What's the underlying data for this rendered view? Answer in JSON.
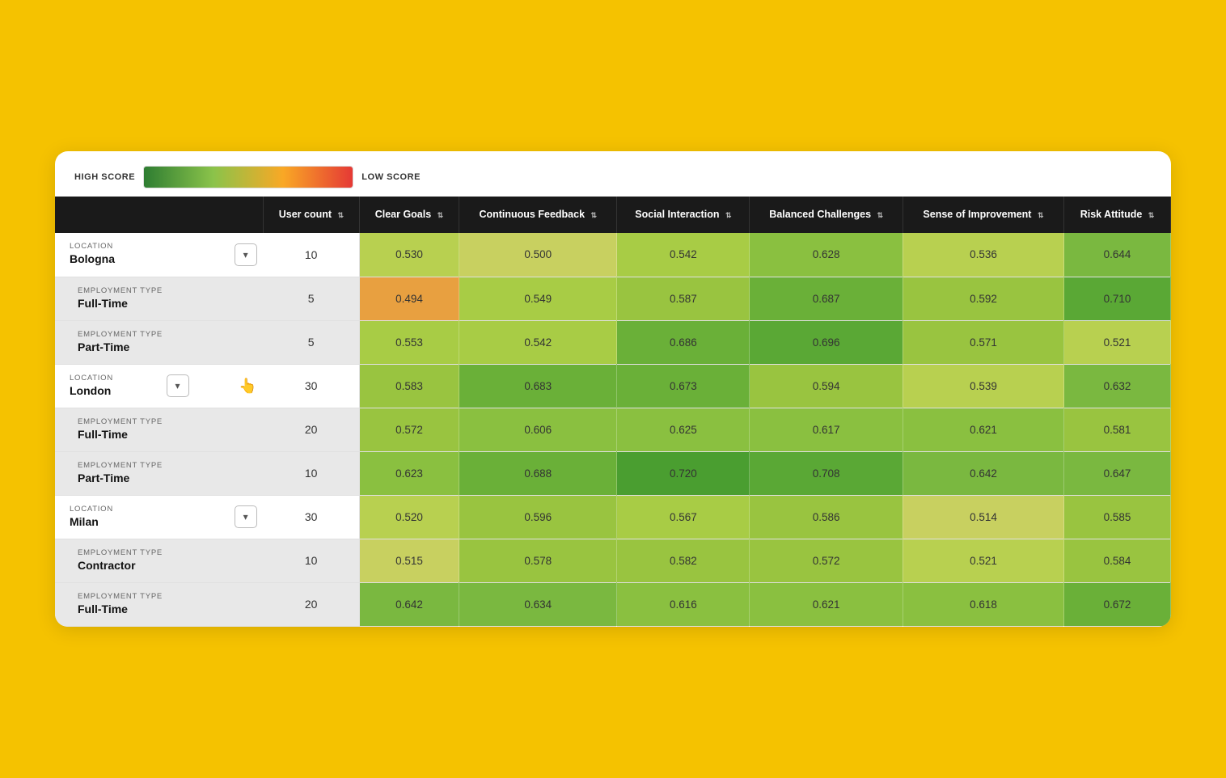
{
  "legend": {
    "high_label": "HIGH SCORE",
    "low_label": "LOW SCORE"
  },
  "columns": [
    {
      "key": "location",
      "label": ""
    },
    {
      "key": "user_count",
      "label": "User count"
    },
    {
      "key": "clear_goals",
      "label": "Clear Goals"
    },
    {
      "key": "continuous_feedback",
      "label": "Continuous Feedback"
    },
    {
      "key": "social_interaction",
      "label": "Social Interaction"
    },
    {
      "key": "balanced_challenges",
      "label": "Balanced Challenges"
    },
    {
      "key": "sense_of_improvement",
      "label": "Sense of Improvement"
    },
    {
      "key": "risk_attitude",
      "label": "Risk Attitude"
    }
  ],
  "rows": [
    {
      "type": "location",
      "type_label": "LOCATION",
      "name": "Bologna",
      "expanded": true,
      "user_count": 10,
      "clear_goals": 0.53,
      "continuous_feedback": 0.5,
      "social_interaction": 0.542,
      "balanced_challenges": 0.628,
      "sense_of_improvement": 0.536,
      "risk_attitude": 0.644
    },
    {
      "type": "employment",
      "type_label": "EMPLOYMENT TYPE",
      "name": "Full-Time",
      "user_count": 5,
      "clear_goals": 0.494,
      "continuous_feedback": 0.549,
      "social_interaction": 0.587,
      "balanced_challenges": 0.687,
      "sense_of_improvement": 0.592,
      "risk_attitude": 0.71
    },
    {
      "type": "employment",
      "type_label": "EMPLOYMENT TYPE",
      "name": "Part-Time",
      "user_count": 5,
      "clear_goals": 0.553,
      "continuous_feedback": 0.542,
      "social_interaction": 0.686,
      "balanced_challenges": 0.696,
      "sense_of_improvement": 0.571,
      "risk_attitude": 0.521
    },
    {
      "type": "location",
      "type_label": "LOCATION",
      "name": "London",
      "expanded": true,
      "user_count": 30,
      "clear_goals": 0.583,
      "continuous_feedback": 0.683,
      "social_interaction": 0.673,
      "balanced_challenges": 0.594,
      "sense_of_improvement": 0.539,
      "risk_attitude": 0.632
    },
    {
      "type": "employment",
      "type_label": "EMPLOYMENT TYPE",
      "name": "Full-Time",
      "user_count": 20,
      "clear_goals": 0.572,
      "continuous_feedback": 0.606,
      "social_interaction": 0.625,
      "balanced_challenges": 0.617,
      "sense_of_improvement": 0.621,
      "risk_attitude": 0.581
    },
    {
      "type": "employment",
      "type_label": "EMPLOYMENT TYPE",
      "name": "Part-Time",
      "user_count": 10,
      "clear_goals": 0.623,
      "continuous_feedback": 0.688,
      "social_interaction": 0.72,
      "balanced_challenges": 0.708,
      "sense_of_improvement": 0.642,
      "risk_attitude": 0.647
    },
    {
      "type": "location",
      "type_label": "LOCATION",
      "name": "Milan",
      "expanded": true,
      "user_count": 30,
      "clear_goals": 0.52,
      "continuous_feedback": 0.596,
      "social_interaction": 0.567,
      "balanced_challenges": 0.586,
      "sense_of_improvement": 0.514,
      "risk_attitude": 0.585
    },
    {
      "type": "employment",
      "type_label": "EMPLOYMENT TYPE",
      "name": "Contractor",
      "user_count": 10,
      "clear_goals": 0.515,
      "continuous_feedback": 0.578,
      "social_interaction": 0.582,
      "balanced_challenges": 0.572,
      "sense_of_improvement": 0.521,
      "risk_attitude": 0.584
    },
    {
      "type": "employment",
      "type_label": "EMPLOYMENT TYPE",
      "name": "Full-Time",
      "user_count": 20,
      "clear_goals": 0.642,
      "continuous_feedback": 0.634,
      "social_interaction": 0.616,
      "balanced_challenges": 0.621,
      "sense_of_improvement": 0.618,
      "risk_attitude": 0.672
    }
  ]
}
